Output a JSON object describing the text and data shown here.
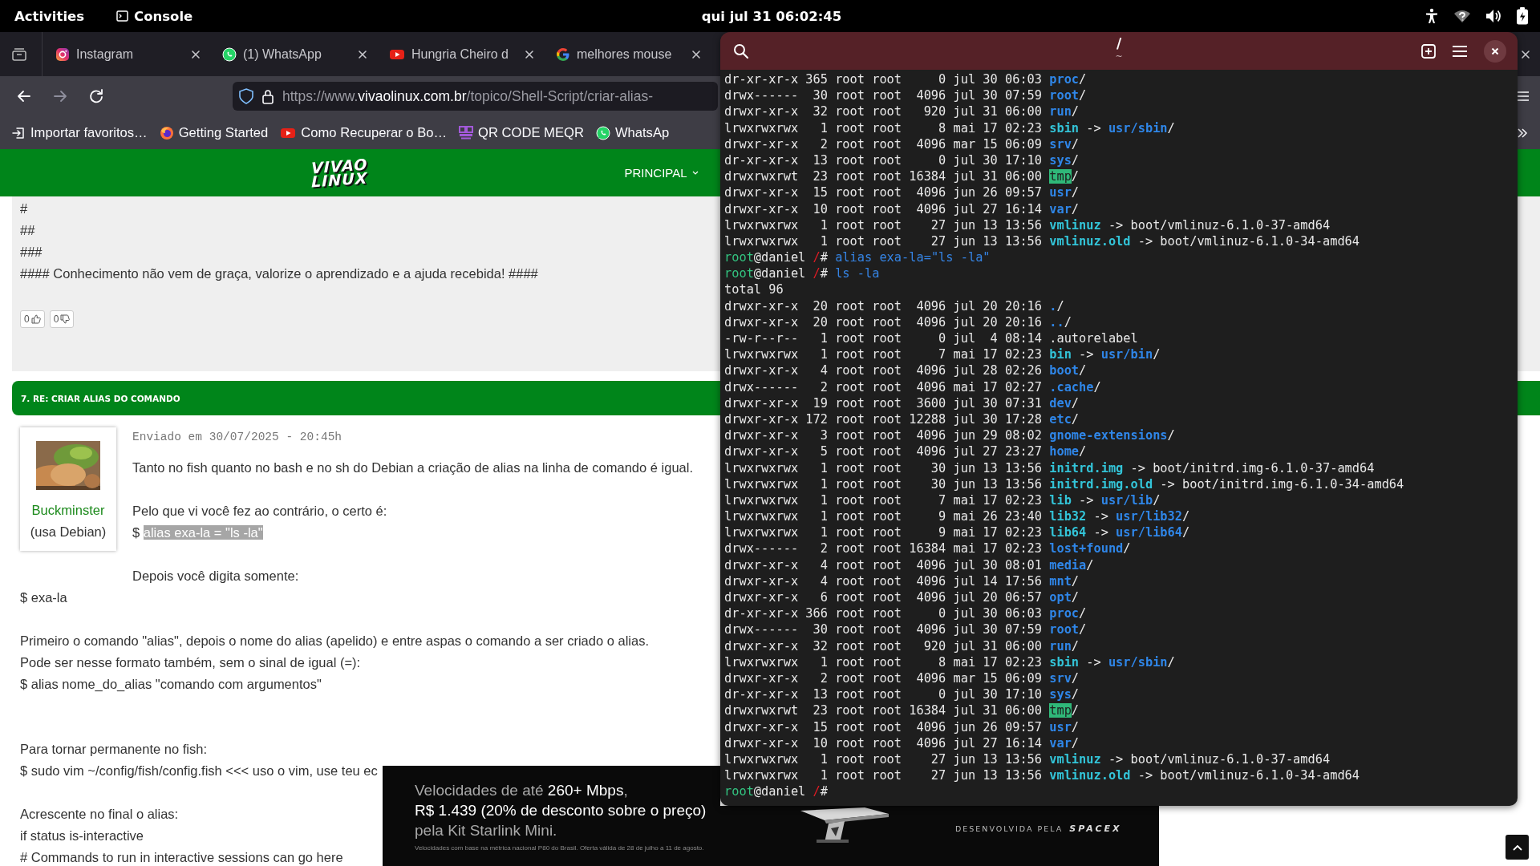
{
  "top_bar": {
    "activities": "Activities",
    "app": "Console",
    "clock": "qui jul 31  06:02:45"
  },
  "browser": {
    "tabs": [
      {
        "title": "Instagram",
        "kind": "instagram"
      },
      {
        "title": "(1) WhatsApp",
        "kind": "whatsapp"
      },
      {
        "title": "Hungria Cheiro d",
        "kind": "youtube"
      },
      {
        "title": "melhores mouse",
        "kind": "google"
      }
    ],
    "url": [
      {
        "text": "https://www.",
        "strong": false
      },
      {
        "text": "vivaolinux.com.br",
        "strong": true
      },
      {
        "text": "/topico/Shell-Script/criar-alias-",
        "strong": false
      }
    ],
    "bookmarks": [
      {
        "title": "Importar favoritos…",
        "kind": "import"
      },
      {
        "title": "Getting Started",
        "kind": "firefox"
      },
      {
        "title": "Como Recuperar o Bo…",
        "kind": "youtube"
      },
      {
        "title": "QR CODE MEQR",
        "kind": "qr"
      },
      {
        "title": "WhatsAp",
        "kind": "whatsapp"
      }
    ],
    "site": {
      "logo_top": "VIVAO",
      "logo_bottom": "LINUX",
      "nav": "PRINCIPAL"
    },
    "signature": [
      "#",
      "##",
      "###",
      "#### Conhecimento não vem de graça, valorize o aprendizado e a ajuda recebida! ####"
    ],
    "votes": [
      {
        "count": "0",
        "kind": "up"
      },
      {
        "count": "0",
        "kind": "down"
      }
    ],
    "reply": {
      "heading": "7. RE: CRIAR ALIAS DO COMANDO",
      "author": "Buckminster",
      "distro": "(usa Debian)",
      "date": "Enviado em 30/07/2025 - 20:45h",
      "lines": [
        {
          "kind": "text",
          "text": "Tanto no fish quanto no bash e no sh do Debian a criação de alias na linha de comando é igual."
        },
        {
          "kind": "gap"
        },
        {
          "kind": "text",
          "text": "Pelo que vi você fez ao contrário, o certo é:"
        },
        {
          "kind": "text",
          "text": "$ ",
          "selected_text": "alias exa-la = \"ls -la\""
        },
        {
          "kind": "gap"
        },
        {
          "kind": "text",
          "text": "Depois você digita somente:"
        },
        {
          "kind": "text",
          "text": "$ exa-la"
        },
        {
          "kind": "gap"
        },
        {
          "kind": "text",
          "text": "Primeiro o comando \"alias\", depois o nome do alias (apelido) e entre aspas o comando a ser criado o alias."
        },
        {
          "kind": "text",
          "text": "Pode ser nesse formato também, sem o sinal de igual (=):"
        },
        {
          "kind": "text",
          "text": "$ alias nome_do_alias \"comando com argumentos\""
        },
        {
          "kind": "gap"
        },
        {
          "kind": "gap"
        },
        {
          "kind": "text",
          "text": "Para tornar permanente no fish:"
        },
        {
          "kind": "text",
          "text": "$ sudo vim ~/config/fish/config.fish <<< uso o vim, use teu ec"
        },
        {
          "kind": "gap"
        },
        {
          "kind": "text",
          "text": "Acrescente no final o alias:"
        },
        {
          "kind": "text",
          "text": "if status is-interactive"
        },
        {
          "kind": "text",
          "text": "# Commands to run in interactive sessions can go here"
        }
      ]
    },
    "ad": {
      "headline": "Velocidades de até **260+ Mbps**,",
      "price": "R$ 1.439 (20% de desconto sobre o preço)",
      "product": "pela Kit Starlink Mini.",
      "fine_print": "Velocidades com base na métrica nacional P80 do Brasil. Oferta válida de 28 de julho a 11 de agosto.",
      "maker": "DESENVOLVIDA PELA",
      "maker_logo": "SPACEX"
    }
  },
  "terminal": {
    "title": "/",
    "subtitle": "~",
    "lines": [
      {
        "kind": "dir",
        "meta": "dr-xr-xr-x 365 root root     0 jul 30 06:03",
        "name": "proc",
        "tail": "/"
      },
      {
        "kind": "dir",
        "meta": "drwx------  30 root root  4096 jul 30 07:59",
        "name": "root",
        "tail": "/"
      },
      {
        "kind": "dir",
        "meta": "drwxr-xr-x  32 root root   920 jul 31 06:00",
        "name": "run",
        "tail": "/"
      },
      {
        "kind": "link_to_dir",
        "meta": "lrwxrwxrwx   1 root root     8 mai 17 02:23",
        "name": "sbin",
        "arrow": "->",
        "target": "usr/sbin",
        "tail": "/"
      },
      {
        "kind": "dir",
        "meta": "drwxr-xr-x   2 root root  4096 mar 15 06:09",
        "name": "srv",
        "tail": "/"
      },
      {
        "kind": "dir",
        "meta": "dr-xr-xr-x  13 root root     0 jul 30 17:10",
        "name": "sys",
        "tail": "/"
      },
      {
        "kind": "sticky",
        "meta": "drwxrwxrwt  23 root root 16384 jul 31 06:00",
        "name": "tmp",
        "tail": "/"
      },
      {
        "kind": "dir",
        "meta": "drwxr-xr-x  15 root root  4096 jun 26 09:57",
        "name": "usr",
        "tail": "/"
      },
      {
        "kind": "dir",
        "meta": "drwxr-xr-x  10 root root  4096 jul 27 16:14",
        "name": "var",
        "tail": "/"
      },
      {
        "kind": "link_to_file",
        "meta": "lrwxrwxrwx   1 root root    27 jun 13 13:56",
        "name": "vmlinuz",
        "arrow": "->",
        "target": "boot/vmlinuz-6.1.0-37-amd64"
      },
      {
        "kind": "link_to_file",
        "meta": "lrwxrwxrwx   1 root root    27 jun 13 13:56",
        "name": "vmlinuz.old",
        "arrow": "->",
        "target": "boot/vmlinuz-6.1.0-34-amd64"
      },
      {
        "kind": "prompt",
        "user": "root",
        "host": "@daniel",
        "cwd": "/",
        "sign": "#",
        "command": "alias exa-la=\"ls -la\""
      },
      {
        "kind": "prompt",
        "user": "root",
        "host": "@daniel",
        "cwd": "/",
        "sign": "#",
        "command": "ls -la"
      },
      {
        "kind": "text",
        "text": "total 96"
      },
      {
        "kind": "dir",
        "meta": "drwxr-xr-x  20 root root  4096 jul 20 20:16",
        "name": ".",
        "tail": "/"
      },
      {
        "kind": "dir",
        "meta": "drwxr-xr-x  20 root root  4096 jul 20 20:16",
        "name": "..",
        "tail": "/"
      },
      {
        "kind": "file",
        "meta": "-rw-r--r--   1 root root     0 jul  4 08:14",
        "name": ".autorelabel"
      },
      {
        "kind": "link_to_dir",
        "meta": "lrwxrwxrwx   1 root root     7 mai 17 02:23",
        "name": "bin",
        "arrow": "->",
        "target": "usr/bin",
        "tail": "/"
      },
      {
        "kind": "dir",
        "meta": "drwxr-xr-x   4 root root  4096 jul 28 02:26",
        "name": "boot",
        "tail": "/"
      },
      {
        "kind": "dir",
        "meta": "drwx------   2 root root  4096 mai 17 02:27",
        "name": ".cache",
        "tail": "/"
      },
      {
        "kind": "dir",
        "meta": "drwxr-xr-x  19 root root  3600 jul 30 07:31",
        "name": "dev",
        "tail": "/"
      },
      {
        "kind": "dir",
        "meta": "drwxr-xr-x 172 root root 12288 jul 30 17:28",
        "name": "etc",
        "tail": "/"
      },
      {
        "kind": "dir",
        "meta": "drwxr-xr-x   3 root root  4096 jun 29 08:02",
        "name": "gnome-extensions",
        "tail": "/"
      },
      {
        "kind": "dir",
        "meta": "drwxr-xr-x   5 root root  4096 jul 27 23:27",
        "name": "home",
        "tail": "/"
      },
      {
        "kind": "link_to_file",
        "meta": "lrwxrwxrwx   1 root root    30 jun 13 13:56",
        "name": "initrd.img",
        "arrow": "->",
        "target": "boot/initrd.img-6.1.0-37-amd64"
      },
      {
        "kind": "link_to_file",
        "meta": "lrwxrwxrwx   1 root root    30 jun 13 13:56",
        "name": "initrd.img.old",
        "arrow": "->",
        "target": "boot/initrd.img-6.1.0-34-amd64"
      },
      {
        "kind": "link_to_dir",
        "meta": "lrwxrwxrwx   1 root root     7 mai 17 02:23",
        "name": "lib",
        "arrow": "->",
        "target": "usr/lib",
        "tail": "/"
      },
      {
        "kind": "link_to_dir",
        "meta": "lrwxrwxrwx   1 root root     9 mai 26 23:40",
        "name": "lib32",
        "arrow": "->",
        "target": "usr/lib32",
        "tail": "/"
      },
      {
        "kind": "link_to_dir",
        "meta": "lrwxrwxrwx   1 root root     9 mai 17 02:23",
        "name": "lib64",
        "arrow": "->",
        "target": "usr/lib64",
        "tail": "/"
      },
      {
        "kind": "dir",
        "meta": "drwx------   2 root root 16384 mai 17 02:23",
        "name": "lost+found",
        "tail": "/"
      },
      {
        "kind": "dir",
        "meta": "drwxr-xr-x   4 root root  4096 jul 30 08:01",
        "name": "media",
        "tail": "/"
      },
      {
        "kind": "dir",
        "meta": "drwxr-xr-x   4 root root  4096 jul 14 17:56",
        "name": "mnt",
        "tail": "/"
      },
      {
        "kind": "dir",
        "meta": "drwxr-xr-x   6 root root  4096 jul 20 06:57",
        "name": "opt",
        "tail": "/"
      },
      {
        "kind": "dir",
        "meta": "dr-xr-xr-x 366 root root     0 jul 30 06:03",
        "name": "proc",
        "tail": "/"
      },
      {
        "kind": "dir",
        "meta": "drwx------  30 root root  4096 jul 30 07:59",
        "name": "root",
        "tail": "/"
      },
      {
        "kind": "dir",
        "meta": "drwxr-xr-x  32 root root   920 jul 31 06:00",
        "name": "run",
        "tail": "/"
      },
      {
        "kind": "link_to_dir",
        "meta": "lrwxrwxrwx   1 root root     8 mai 17 02:23",
        "name": "sbin",
        "arrow": "->",
        "target": "usr/sbin",
        "tail": "/"
      },
      {
        "kind": "dir",
        "meta": "drwxr-xr-x   2 root root  4096 mar 15 06:09",
        "name": "srv",
        "tail": "/"
      },
      {
        "kind": "dir",
        "meta": "dr-xr-xr-x  13 root root     0 jul 30 17:10",
        "name": "sys",
        "tail": "/"
      },
      {
        "kind": "sticky",
        "meta": "drwxrwxrwt  23 root root 16384 jul 31 06:00",
        "name": "tmp",
        "tail": "/"
      },
      {
        "kind": "dir",
        "meta": "drwxr-xr-x  15 root root  4096 jun 26 09:57",
        "name": "usr",
        "tail": "/"
      },
      {
        "kind": "dir",
        "meta": "drwxr-xr-x  10 root root  4096 jul 27 16:14",
        "name": "var",
        "tail": "/"
      },
      {
        "kind": "link_to_file",
        "meta": "lrwxrwxrwx   1 root root    27 jun 13 13:56",
        "name": "vmlinuz",
        "arrow": "->",
        "target": "boot/vmlinuz-6.1.0-37-amd64"
      },
      {
        "kind": "link_to_file",
        "meta": "lrwxrwxrwx   1 root root    27 jun 13 13:56",
        "name": "vmlinuz.old",
        "arrow": "->",
        "target": "boot/vmlinuz-6.1.0-34-amd64"
      },
      {
        "kind": "prompt",
        "user": "root",
        "host": "@daniel",
        "cwd": "/",
        "sign": "#"
      }
    ]
  }
}
